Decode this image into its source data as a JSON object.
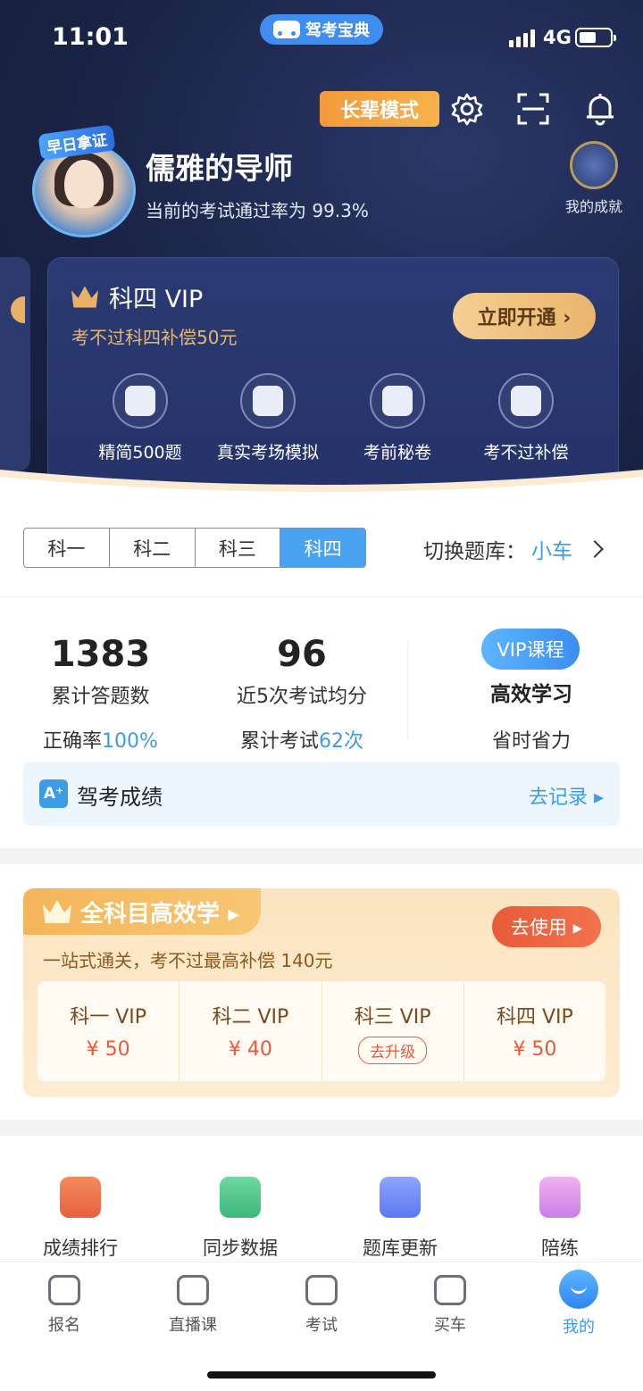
{
  "status_bar": {
    "time": "11:01",
    "network": "4G"
  },
  "app_brand": "驾考宝典",
  "header": {
    "elder_mode": "长辈模式",
    "badge": "早日拿证",
    "username": "儒雅的导师",
    "pass_rate": "当前的考试通过率为 99.3%",
    "achievement_label": "我的成就"
  },
  "vip_card": {
    "title": "科四 VIP",
    "subtitle": "考不过科四补偿50元",
    "open_button": "立即开通 ›",
    "perks": [
      "精简500题",
      "真实考场模拟",
      "考前秘卷",
      "考不过补偿"
    ]
  },
  "subject_tabs": {
    "items": [
      "科一",
      "科二",
      "科三",
      "科四"
    ],
    "active": "科四"
  },
  "switch_bank": {
    "label": "切换题库：",
    "value": "小车"
  },
  "stats": {
    "answered": {
      "value": "1383",
      "label": "累计答题数",
      "sub_prefix": "正确率",
      "sub_value": "100%"
    },
    "avg": {
      "value": "96",
      "label": "近5次考试均分",
      "sub_prefix": "累计考试",
      "sub_value": "62次"
    },
    "course_badge": "VIP课程",
    "course_title": "高效学习",
    "course_sub": "省时省力"
  },
  "record": {
    "icon_text": "A⁺",
    "title": "驾考成绩",
    "action": "去记录 ▸"
  },
  "promo": {
    "title": "全科目高效学 ▸",
    "button": "去使用 ▸",
    "subtitle": "一站式通关，考不过最高补偿 140元",
    "items": [
      {
        "name": "科一 VIP",
        "price": "¥ 50"
      },
      {
        "name": "科二 VIP",
        "price": "¥ 40"
      },
      {
        "name": "科三 VIP",
        "upgrade": "去升级"
      },
      {
        "name": "科四 VIP",
        "price": "¥ 50"
      }
    ]
  },
  "tools": [
    "成绩排行",
    "同步数据",
    "题库更新",
    "陪练"
  ],
  "tabbar": {
    "items": [
      "报名",
      "直播课",
      "考试",
      "买车",
      "我的"
    ],
    "active": "我的"
  },
  "colors": {
    "accent": "#3d9be8",
    "header_bg": "#1b2447",
    "gold": "#e9b56c",
    "promo_red": "#e85a3a"
  }
}
